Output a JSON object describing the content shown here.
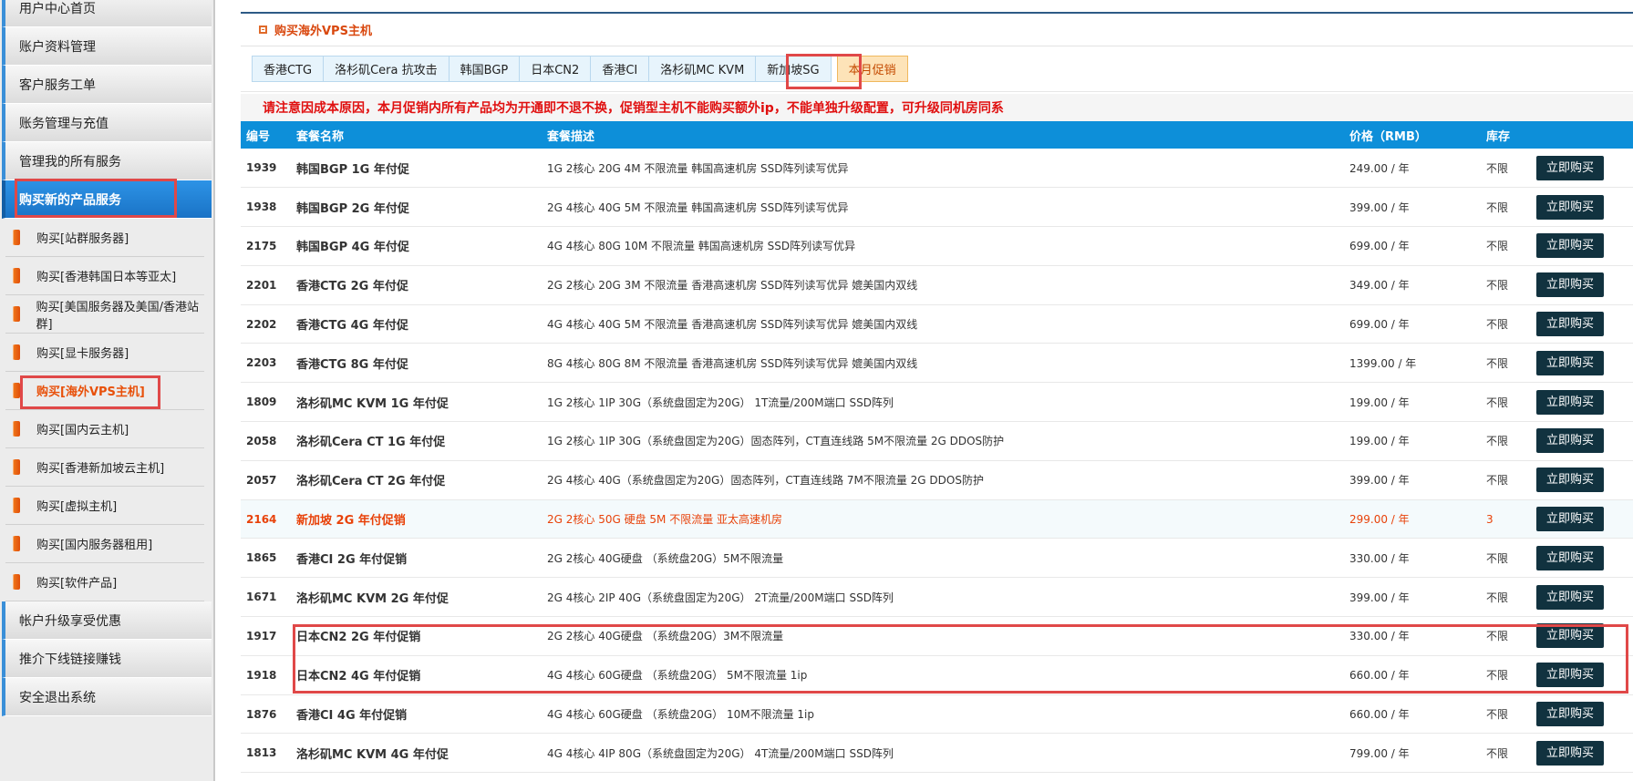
{
  "sidebar": {
    "top_items": [
      {
        "label": "用户中心首页"
      },
      {
        "label": "账户资料管理"
      },
      {
        "label": "客户服务工单"
      },
      {
        "label": "账务管理与充值"
      },
      {
        "label": "管理我的所有服务"
      },
      {
        "label": "购买新的产品服务"
      }
    ],
    "sub_items": [
      {
        "label": "购买[站群服务器]"
      },
      {
        "label": "购买[香港韩国日本等亚太]"
      },
      {
        "label": "购买[美国服务器及美国/香港站群]"
      },
      {
        "label": "购买[显卡服务器]"
      },
      {
        "label": "购买[海外VPS主机]"
      },
      {
        "label": "购买[国内云主机]"
      },
      {
        "label": "购买[香港新加坡云主机]"
      },
      {
        "label": "购买[虚拟主机]"
      },
      {
        "label": "购买[国内服务器租用]"
      },
      {
        "label": "购买[软件产品]"
      }
    ],
    "bottom_items": [
      {
        "label": "帐户升级享受优惠"
      },
      {
        "label": "推介下线链接赚钱"
      },
      {
        "label": "安全退出系统"
      }
    ]
  },
  "panel": {
    "title": "购买海外VPS主机",
    "tabs": [
      "香港CTG",
      "洛杉矶Cera 抗攻击",
      "韩国BGP",
      "日本CN2",
      "香港CI",
      "洛杉矶MC KVM",
      "新加坡SG"
    ],
    "active_tab": "本月促销",
    "notice": "请注意因成本原因，本月促销内所有产品均为开通即不退不换，促销型主机不能购买额外ip，不能单独升级配置，可升级同机房同系"
  },
  "table": {
    "headers": [
      "编号",
      "套餐名称",
      "套餐描述",
      "价格（RMB）",
      "库存",
      ""
    ],
    "buy_label": "立即购买",
    "rows": [
      {
        "id": "1939",
        "name": "韩国BGP 1G 年付促",
        "desc": "1G 2核心 20G 4M 不限流量 韩国高速机房 SSD阵列读写优异",
        "price": "249.00 / 年",
        "stock": "不限"
      },
      {
        "id": "1938",
        "name": "韩国BGP 2G 年付促",
        "desc": "2G 4核心 40G 5M 不限流量 韩国高速机房 SSD阵列读写优异",
        "price": "399.00 / 年",
        "stock": "不限"
      },
      {
        "id": "2175",
        "name": "韩国BGP 4G 年付促",
        "desc": "4G 4核心 80G 10M 不限流量 韩国高速机房 SSD阵列读写优异",
        "price": "699.00 / 年",
        "stock": "不限"
      },
      {
        "id": "2201",
        "name": "香港CTG 2G 年付促",
        "desc": "2G 2核心 20G 3M 不限流量 香港高速机房 SSD阵列读写优异 媲美国内双线",
        "price": "349.00 / 年",
        "stock": "不限"
      },
      {
        "id": "2202",
        "name": "香港CTG 4G 年付促",
        "desc": "4G 4核心 40G 5M 不限流量 香港高速机房 SSD阵列读写优异 媲美国内双线",
        "price": "699.00 / 年",
        "stock": "不限"
      },
      {
        "id": "2203",
        "name": "香港CTG 8G 年付促",
        "desc": "8G 4核心 80G 8M 不限流量 香港高速机房 SSD阵列读写优异 媲美国内双线",
        "price": "1399.00 / 年",
        "stock": "不限"
      },
      {
        "id": "1809",
        "name": "洛杉矶MC KVM 1G 年付促",
        "desc": "1G 2核心 1IP 30G（系统盘固定为20G） 1T流量/200M端口 SSD阵列",
        "price": "199.00 / 年",
        "stock": "不限"
      },
      {
        "id": "2058",
        "name": "洛杉矶Cera CT 1G 年付促",
        "desc": "1G 2核心 1IP 30G（系统盘固定为20G）固态阵列，CT直连线路 5M不限流量   2G DDOS防护",
        "price": "199.00 / 年",
        "stock": "不限"
      },
      {
        "id": "2057",
        "name": "洛杉矶Cera CT 2G 年付促",
        "desc": "2G 4核心 40G（系统盘固定为20G）固态阵列，CT直连线路 7M不限流量 2G DDOS防护",
        "price": "399.00 / 年",
        "stock": "不限"
      },
      {
        "id": "2164",
        "name": "新加坡 2G 年付促销",
        "desc": "2G 2核心 50G 硬盘 5M 不限流量 亚太高速机房",
        "price": "299.00 / 年",
        "stock": "3",
        "highlight": true
      },
      {
        "id": "1865",
        "name": "香港CI 2G 年付促销",
        "desc": "2G 2核心 40G硬盘 （系统盘20G）5M不限流量",
        "price": "330.00 / 年",
        "stock": "不限"
      },
      {
        "id": "1671",
        "name": "洛杉矶MC KVM 2G 年付促",
        "desc": "2G 4核心 2IP 40G（系统盘固定为20G） 2T流量/200M端口 SSD阵列",
        "price": "399.00 / 年",
        "stock": "不限"
      },
      {
        "id": "1917",
        "name": "日本CN2 2G 年付促销",
        "desc": "2G 2核心 40G硬盘 （系统盘20G）3M不限流量",
        "price": "330.00 / 年",
        "stock": "不限"
      },
      {
        "id": "1918",
        "name": "日本CN2 4G 年付促销",
        "desc": "4G 4核心 60G硬盘 （系统盘20G） 5M不限流量 1ip",
        "price": "660.00 / 年",
        "stock": "不限"
      },
      {
        "id": "1876",
        "name": "香港CI 4G 年付促销",
        "desc": "4G 4核心 60G硬盘 （系统盘20G） 10M不限流量 1ip",
        "price": "660.00 / 年",
        "stock": "不限"
      },
      {
        "id": "1813",
        "name": "洛杉矶MC KVM 4G 年付促",
        "desc": "4G 4核心 4IP 80G（系统盘固定为20G） 4T流量/200M端口 SSD阵列",
        "price": "799.00 / 年",
        "stock": "不限"
      }
    ]
  },
  "colors": {
    "header_blue": "#0d8fd9",
    "sidebar_active": "#1a73c6",
    "notice_red": "#e01010",
    "highlight_row_text": "#e8420a",
    "buy_button": "#11323f",
    "annotation_red": "#e04848"
  },
  "icons": {
    "sub_item_icon": "server-icon",
    "title_icon": "square-bullet-icon"
  }
}
